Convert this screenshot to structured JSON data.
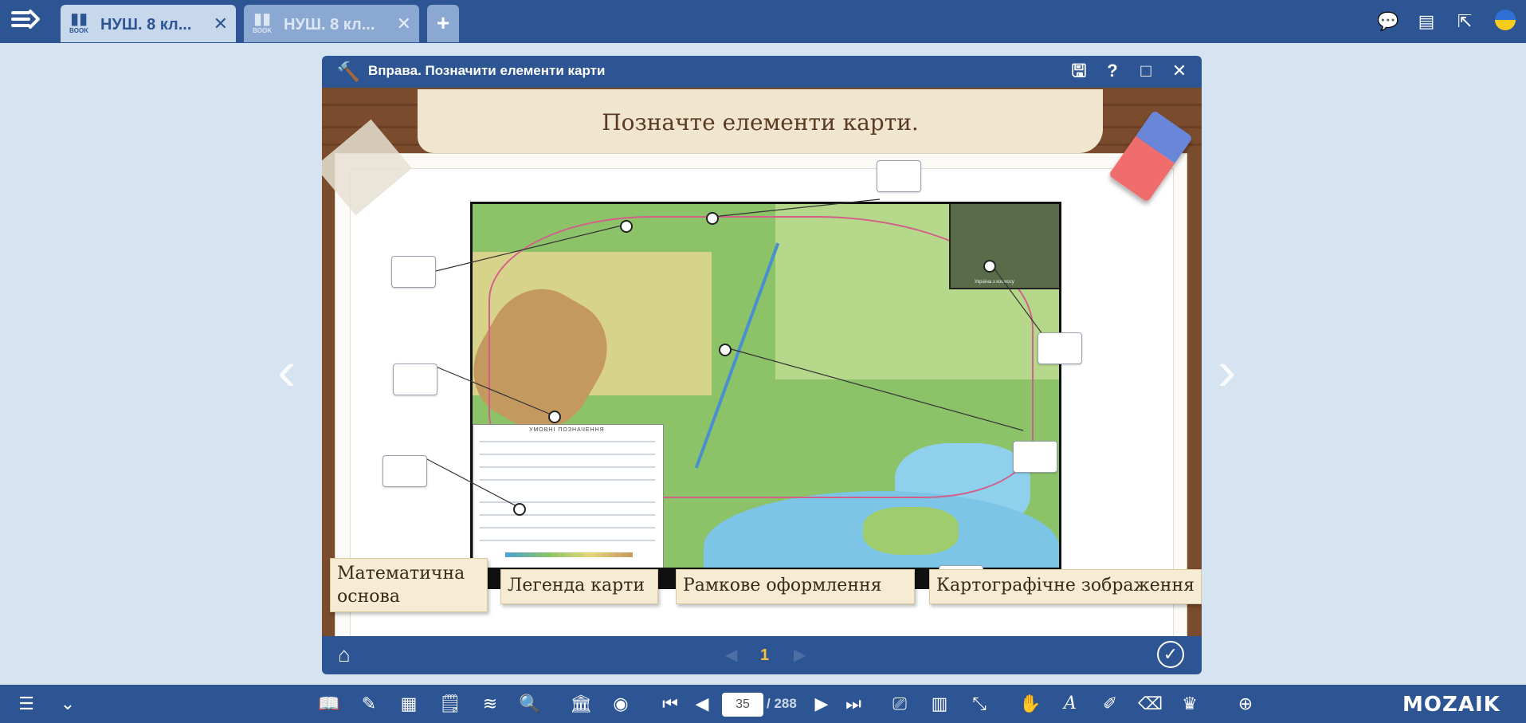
{
  "tabs": [
    {
      "label": "НУШ. 8 кл...",
      "book_badge": "BOOK"
    },
    {
      "label": "НУШ. 8 кл...",
      "book_badge": "BOOK"
    }
  ],
  "dialog": {
    "title": "Вправа. Позначити елементи карти",
    "instruction": "Позначте елементи карти.",
    "page_number": "1"
  },
  "map": {
    "legend_caption": "УМОВНІ ПОЗНАЧЕННЯ",
    "inset_caption": "Україна з космосу"
  },
  "answer_cards": [
    {
      "label": "Математична основа"
    },
    {
      "label": "Легенда карти"
    },
    {
      "label": "Рамкове оформлення"
    },
    {
      "label": "Картографічне зображення"
    }
  ],
  "toolbar": {
    "current_page": "35",
    "total_pages": "/ 288",
    "logo": "MOZAIK"
  },
  "icons": [
    "menu-icon",
    "book-icon",
    "close-icon",
    "plus-icon",
    "chat-icon",
    "newspaper-icon",
    "external-link-icon",
    "language-flag-icon",
    "hammer-icon",
    "save-icon",
    "help-icon",
    "maximize-icon",
    "home-icon",
    "check-circle-icon",
    "hamburger-icon",
    "chevron-down-icon",
    "zoom-icon"
  ],
  "colors": {
    "primary": "#2e5593",
    "tab_active": "#c8d8ec",
    "page_accent": "#f5c043",
    "card": "#f5ecd3"
  }
}
